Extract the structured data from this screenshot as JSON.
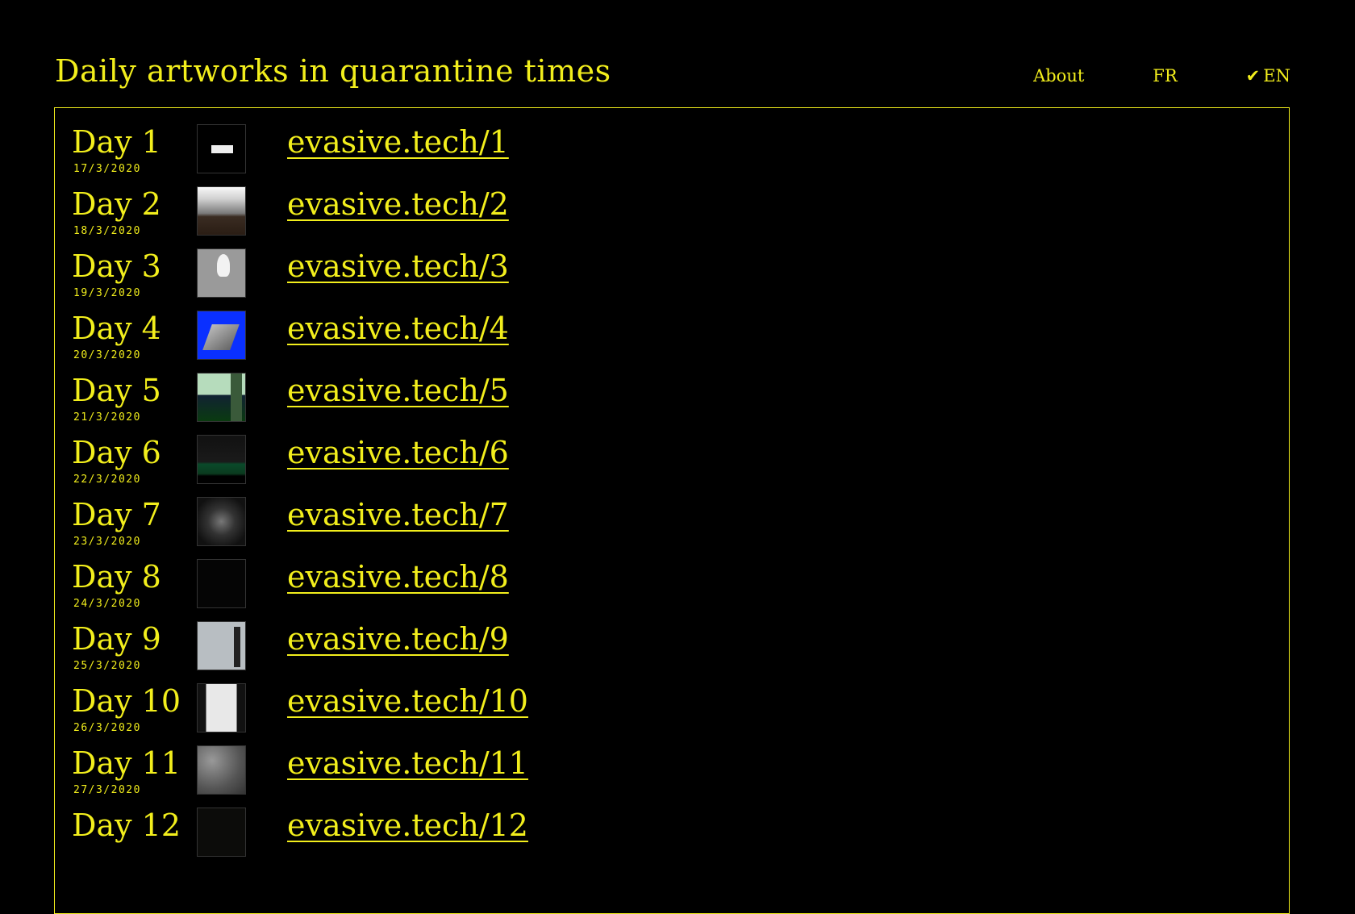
{
  "header": {
    "title": "Daily artworks in quarantine times",
    "nav": {
      "about": "About",
      "fr": "FR",
      "check": "✔",
      "en": "EN"
    }
  },
  "days": [
    {
      "label": "Day 1",
      "date": "17/3/2020",
      "link": "evasive.tech/1"
    },
    {
      "label": "Day 2",
      "date": "18/3/2020",
      "link": "evasive.tech/2"
    },
    {
      "label": "Day 3",
      "date": "19/3/2020",
      "link": "evasive.tech/3"
    },
    {
      "label": "Day 4",
      "date": "20/3/2020",
      "link": "evasive.tech/4"
    },
    {
      "label": "Day 5",
      "date": "21/3/2020",
      "link": "evasive.tech/5"
    },
    {
      "label": "Day 6",
      "date": "22/3/2020",
      "link": "evasive.tech/6"
    },
    {
      "label": "Day 7",
      "date": "23/3/2020",
      "link": "evasive.tech/7"
    },
    {
      "label": "Day 8",
      "date": "24/3/2020",
      "link": "evasive.tech/8"
    },
    {
      "label": "Day 9",
      "date": "25/3/2020",
      "link": "evasive.tech/9"
    },
    {
      "label": "Day 10",
      "date": "26/3/2020",
      "link": "evasive.tech/10"
    },
    {
      "label": "Day 11",
      "date": "27/3/2020",
      "link": "evasive.tech/11"
    },
    {
      "label": "Day 12",
      "date": "",
      "link": "evasive.tech/12"
    }
  ],
  "colors": {
    "accent": "#f2ee1c",
    "background": "#000000"
  }
}
